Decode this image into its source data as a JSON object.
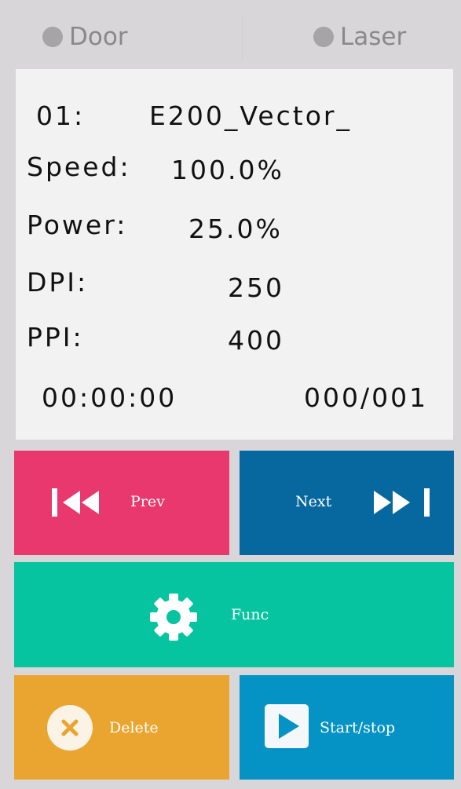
{
  "status": {
    "door_label": "Door",
    "laser_label": "Laser"
  },
  "info": {
    "file_index": "01:",
    "file_name": "E200_Vector_",
    "speed_label": "Speed:",
    "speed_value": "100.0%",
    "power_label": "Power:",
    "power_value": "25.0%",
    "dpi_label": "DPI:",
    "dpi_value": "250",
    "ppi_label": "PPI:",
    "ppi_value": "400",
    "elapsed_time": "00:00:00",
    "file_counter": "000/001"
  },
  "buttons": {
    "prev_label": "Prev",
    "next_label": "Next",
    "func_label": "Func",
    "delete_label": "Delete",
    "start_label": "Start/stop"
  },
  "colors": {
    "prev": "#e8386d",
    "next": "#07679f",
    "func": "#06c49f",
    "delete": "#eaa530",
    "start": "#0593c5",
    "indicator_off": "#a6a4a6"
  },
  "icons": {
    "prev": "skip-previous-icon",
    "next": "skip-next-icon",
    "func": "gear-icon",
    "delete": "close-circle-icon",
    "start": "play-icon",
    "status": "indicator-dot-icon"
  }
}
